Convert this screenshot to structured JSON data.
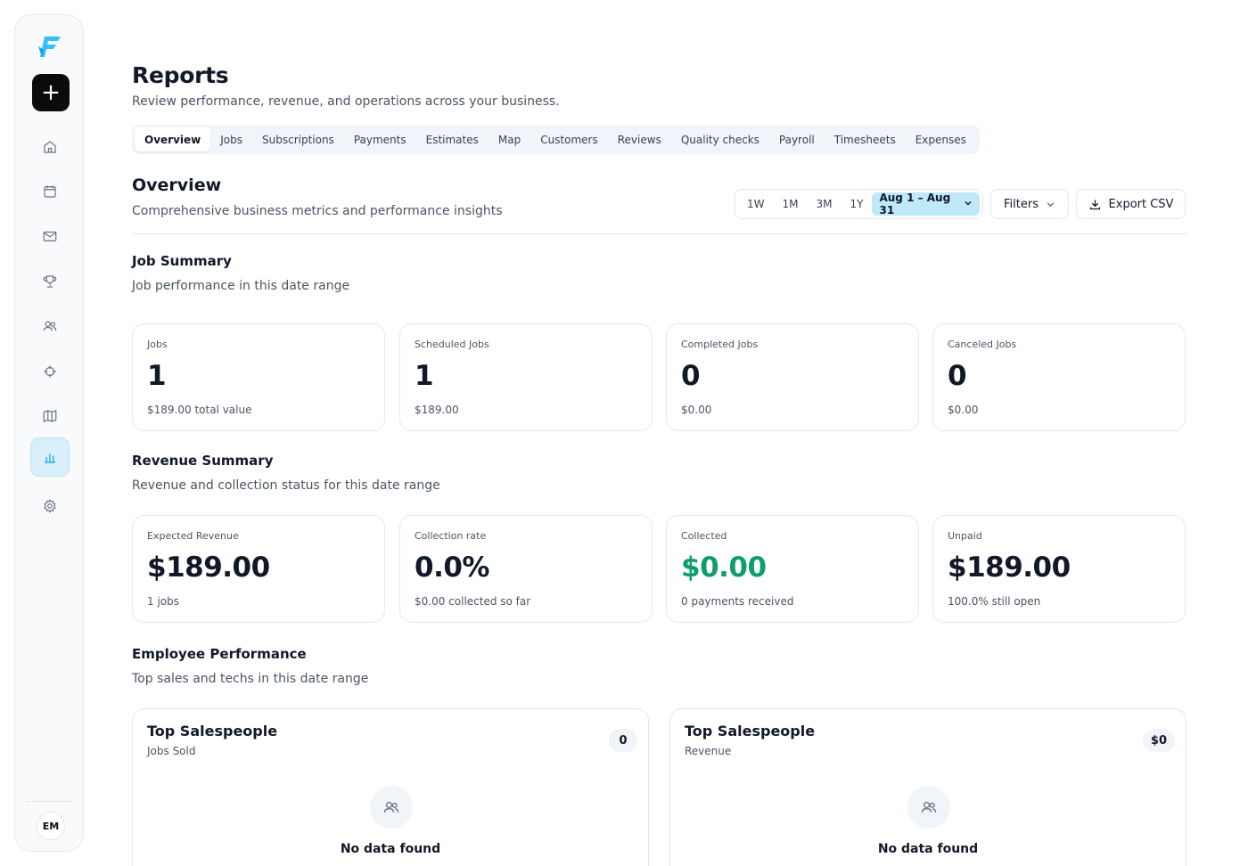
{
  "sidebar": {
    "user_initials": "EM",
    "items": [
      {
        "name": "home-icon"
      },
      {
        "name": "calendar-icon"
      },
      {
        "name": "mail-icon"
      },
      {
        "name": "trophy-icon"
      },
      {
        "name": "users-icon"
      },
      {
        "name": "crosshair-icon"
      },
      {
        "name": "map-icon"
      },
      {
        "name": "bar-chart-icon",
        "active": true
      },
      {
        "name": "gear-icon"
      }
    ]
  },
  "header": {
    "title": "Reports",
    "subtitle": "Review performance, revenue, and operations across your business."
  },
  "tabs": [
    "Overview",
    "Jobs",
    "Subscriptions",
    "Payments",
    "Estimates",
    "Map",
    "Customers",
    "Reviews",
    "Quality checks",
    "Payroll",
    "Timesheets",
    "Expenses"
  ],
  "overview": {
    "title": "Overview",
    "subtitle": "Comprehensive business metrics and performance insights",
    "ranges": [
      "1W",
      "1M",
      "3M",
      "1Y"
    ],
    "date_range": "Aug 1 – Aug 31",
    "filters_label": "Filters",
    "export_label": "Export CSV"
  },
  "job_summary": {
    "title": "Job Summary",
    "subtitle": "Job performance in this date range",
    "cards": [
      {
        "label": "Jobs",
        "value": "1",
        "note": "$189.00 total value"
      },
      {
        "label": "Scheduled Jobs",
        "value": "1",
        "note": "$189.00"
      },
      {
        "label": "Completed Jobs",
        "value": "0",
        "note": "$0.00"
      },
      {
        "label": "Canceled Jobs",
        "value": "0",
        "note": "$0.00"
      }
    ]
  },
  "revenue_summary": {
    "title": "Revenue Summary",
    "subtitle": "Revenue and collection status for this date range",
    "cards": [
      {
        "label": "Expected Revenue",
        "value": "$189.00",
        "note": "1 jobs"
      },
      {
        "label": "Collection rate",
        "value": "0.0%",
        "note": "$0.00 collected so far"
      },
      {
        "label": "Collected",
        "value": "$0.00",
        "note": "0 payments received"
      },
      {
        "label": "Unpaid",
        "value": "$189.00",
        "note": "100.0% still open"
      }
    ],
    "collected_color": "#0f9d6e"
  },
  "employee_performance": {
    "title": "Employee Performance",
    "subtitle": "Top sales and techs in this date range",
    "panels": [
      {
        "title": "Top Salespeople",
        "subtitle": "Jobs Sold",
        "badge": "0",
        "empty": "No data found"
      },
      {
        "title": "Top Salespeople",
        "subtitle": "Revenue",
        "badge": "$0",
        "empty": "No data found"
      }
    ]
  }
}
